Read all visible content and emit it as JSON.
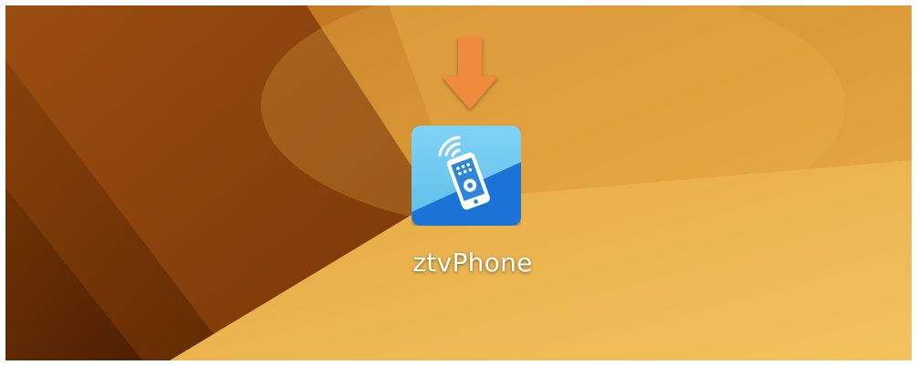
{
  "desktop": {
    "wallpaper_colors": [
      "#7a3a08",
      "#a55a15",
      "#d49232",
      "#eeb755"
    ],
    "app": {
      "label": "ztvPhone",
      "icon": "phone-remote-wifi-icon",
      "icon_colors": {
        "light": "#6ec9f0",
        "dark": "#1b73d6"
      }
    },
    "pointer": {
      "icon": "arrow-down-icon",
      "color": "#f08a3c"
    }
  }
}
